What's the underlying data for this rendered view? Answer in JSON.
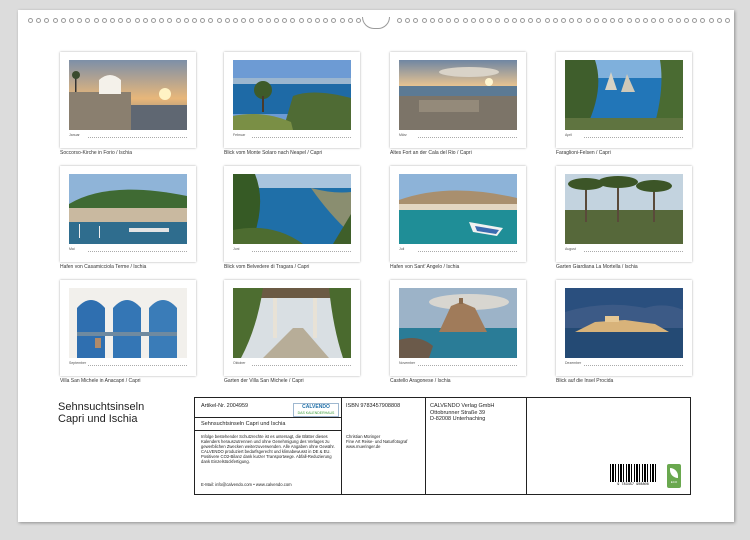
{
  "months": [
    {
      "label": "Januar",
      "caption": "Soccorso-Kirche in Forio / Ischia"
    },
    {
      "label": "Februar",
      "caption": "Blick vom Monte Solaro nach Neapel / Capri"
    },
    {
      "label": "März",
      "caption": "Altes Fort an der Cala del Rio / Capri"
    },
    {
      "label": "April",
      "caption": "Faraglioni-Felsen / Capri"
    },
    {
      "label": "Mai",
      "caption": "Hafen von Casamicciola Terme / Ischia"
    },
    {
      "label": "Juni",
      "caption": "Blick vom Belvedere di Tragara / Capri"
    },
    {
      "label": "Juli",
      "caption": "Hafen von Sant' Angelo / Ischia"
    },
    {
      "label": "August",
      "caption": "Garten Giardiana La Mortella / Ischia"
    },
    {
      "label": "September",
      "caption": "Villa San Michele in Anacapri / Capri"
    },
    {
      "label": "Oktober",
      "caption": "Garten der Villa San Michele / Capri"
    },
    {
      "label": "November",
      "caption": "Castello Aragonese / Ischia"
    },
    {
      "label": "Dezember",
      "caption": "Blick auf die Insel Procida"
    }
  ],
  "title": {
    "line1": "Sehnsuchtsinseln",
    "line2": "Capri und Ischia"
  },
  "info": {
    "article": "Artikel-Nr. 2004959",
    "product_title": "Sehnsuchtsinseln Capri und Ischia",
    "legal": "Infolge bestehender Schutzrechte ist es untersagt, die Blätter dieses Kalenders herauszutrennen und ohne Genehmigung des Verlages zu gewerblichen Zwecken weiterzuverwenden. Alle Angaben ohne Gewähr. CALVENDO produziert bedarfsgerecht und klimabewusst in DE & EU. Positivere CO2-Bilanz dank kurzer Transportwege. Abfall-Reduzierung dank Einzelstückfertigung.",
    "contact": "E-Mail: info@calvendo.com • www.calvendo.com",
    "isbn": "ISBN 9783457908808",
    "author_name": "Christian Müringer",
    "author_role": "Fine Art Reise- und Naturfotograf",
    "author_web": "www.mueringer.de",
    "publisher_name": "CALVENDO Verlag GmbH",
    "publisher_street": "Ottobrunner Straße 39",
    "publisher_city": "D-82008 Unterhaching",
    "logo_brand": "CALVENDO",
    "logo_tag": "DAS KALENDERHAUS",
    "barcode_number": "9 783457 908808",
    "eco_label": "ECO"
  }
}
